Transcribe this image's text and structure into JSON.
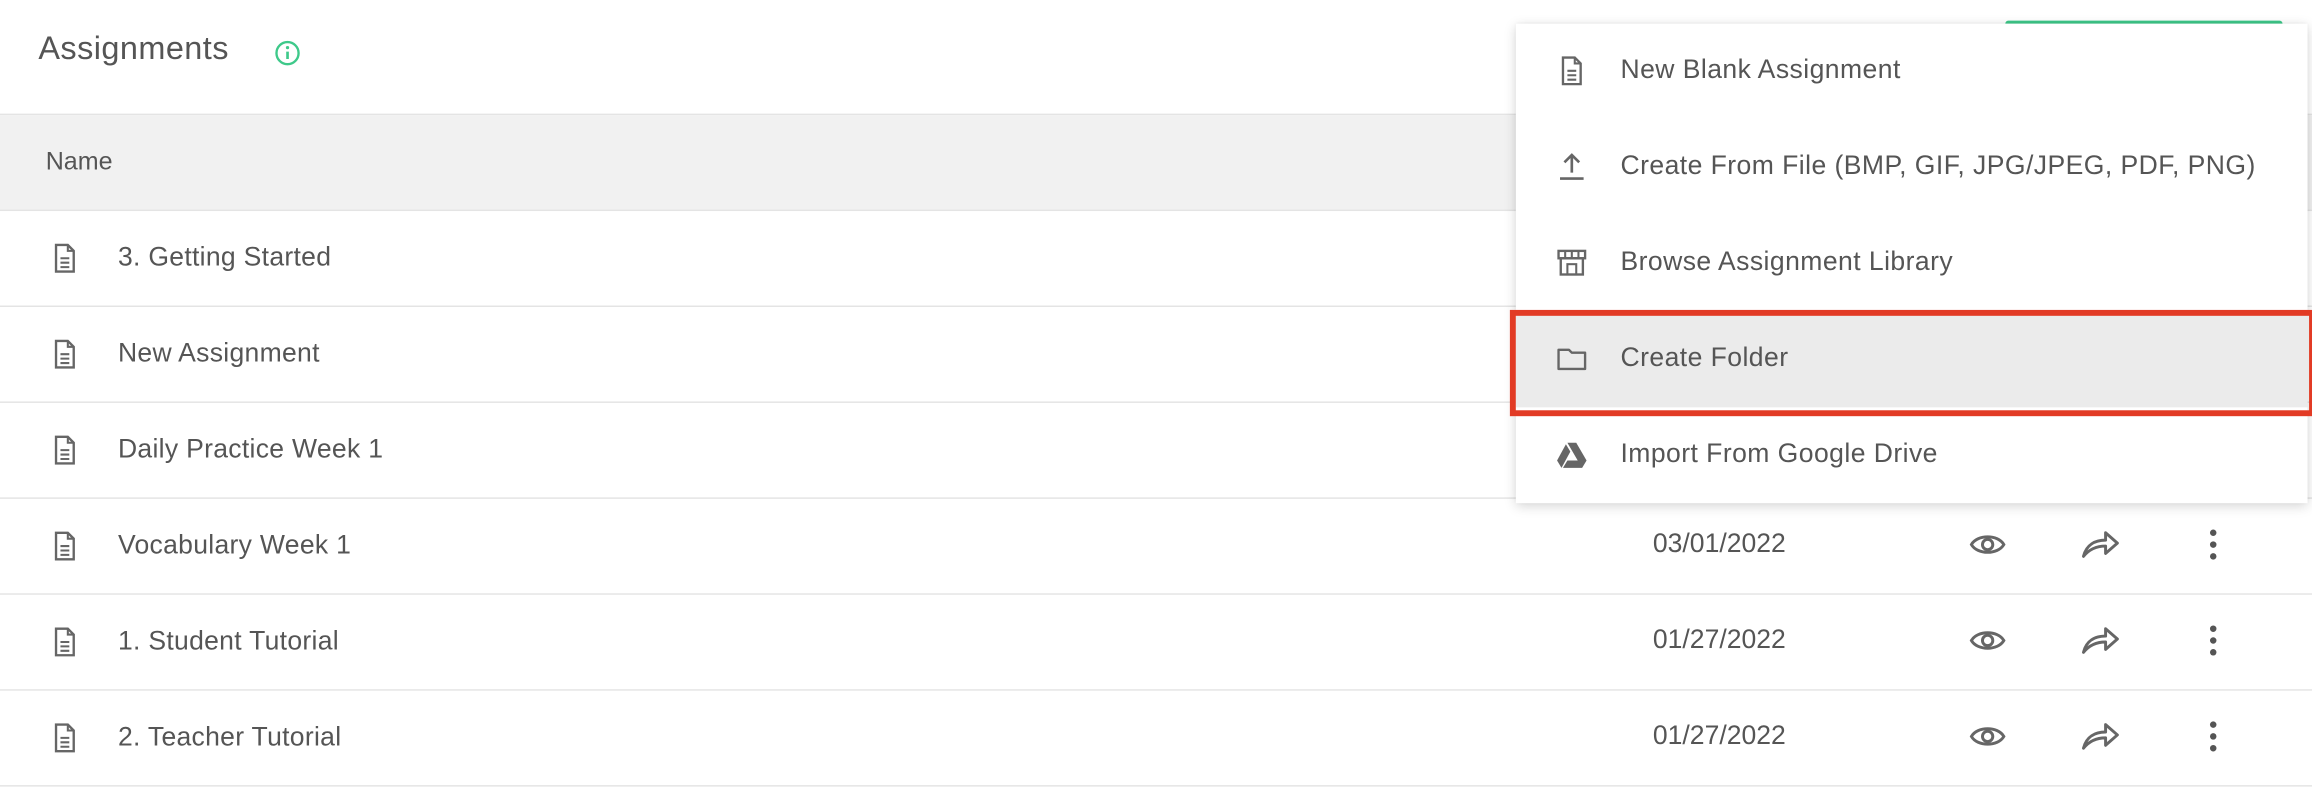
{
  "header": {
    "title": "Assignments"
  },
  "table": {
    "column_name": "Name",
    "rows": [
      {
        "name": "3. Getting Started",
        "date": ""
      },
      {
        "name": "New Assignment",
        "date": ""
      },
      {
        "name": "Daily Practice Week 1",
        "date": ""
      },
      {
        "name": "Vocabulary Week 1",
        "date": "03/01/2022"
      },
      {
        "name": "1. Student Tutorial",
        "date": "01/27/2022"
      },
      {
        "name": "2. Teacher Tutorial",
        "date": "01/27/2022"
      }
    ]
  },
  "menu": {
    "items": [
      {
        "label": "New Blank Assignment",
        "icon": "document-icon"
      },
      {
        "label": "Create From File (BMP, GIF, JPG/JPEG, PDF, PNG)",
        "icon": "upload-icon"
      },
      {
        "label": "Browse Assignment Library",
        "icon": "library-icon"
      },
      {
        "label": "Create Folder",
        "icon": "folder-icon"
      },
      {
        "label": "Import From Google Drive",
        "icon": "google-drive-icon"
      }
    ],
    "highlighted_index": 3
  },
  "colors": {
    "accent_green": "#3ec98a",
    "highlight_red": "#e23b25",
    "text": "#555555",
    "header_bg": "#f1f1f1"
  }
}
